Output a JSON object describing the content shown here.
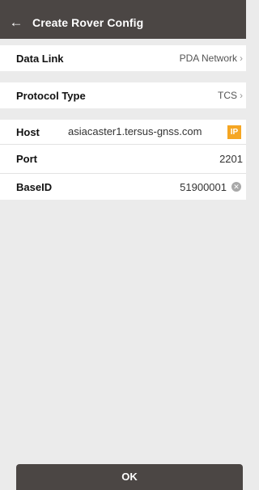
{
  "header": {
    "back_icon": "←",
    "title": "Create Rover Config"
  },
  "rows": {
    "data_link": {
      "label": "Data Link",
      "value": "PDA Network",
      "chevron": "›"
    },
    "protocol_type": {
      "label": "Protocol Type",
      "value": "TCS",
      "chevron": "›"
    },
    "host": {
      "label": "Host",
      "value": "asiacaster1.tersus-gnss.com",
      "badge": "IP"
    },
    "port": {
      "label": "Port",
      "value": "2201"
    },
    "base_id": {
      "label": "BaseID",
      "value": "51900001",
      "clear_icon": "✕"
    }
  },
  "footer": {
    "ok_label": "OK"
  },
  "colors": {
    "header_bg": "#4b4644",
    "accent": "#f5a623",
    "page_bg": "#ebebeb"
  }
}
